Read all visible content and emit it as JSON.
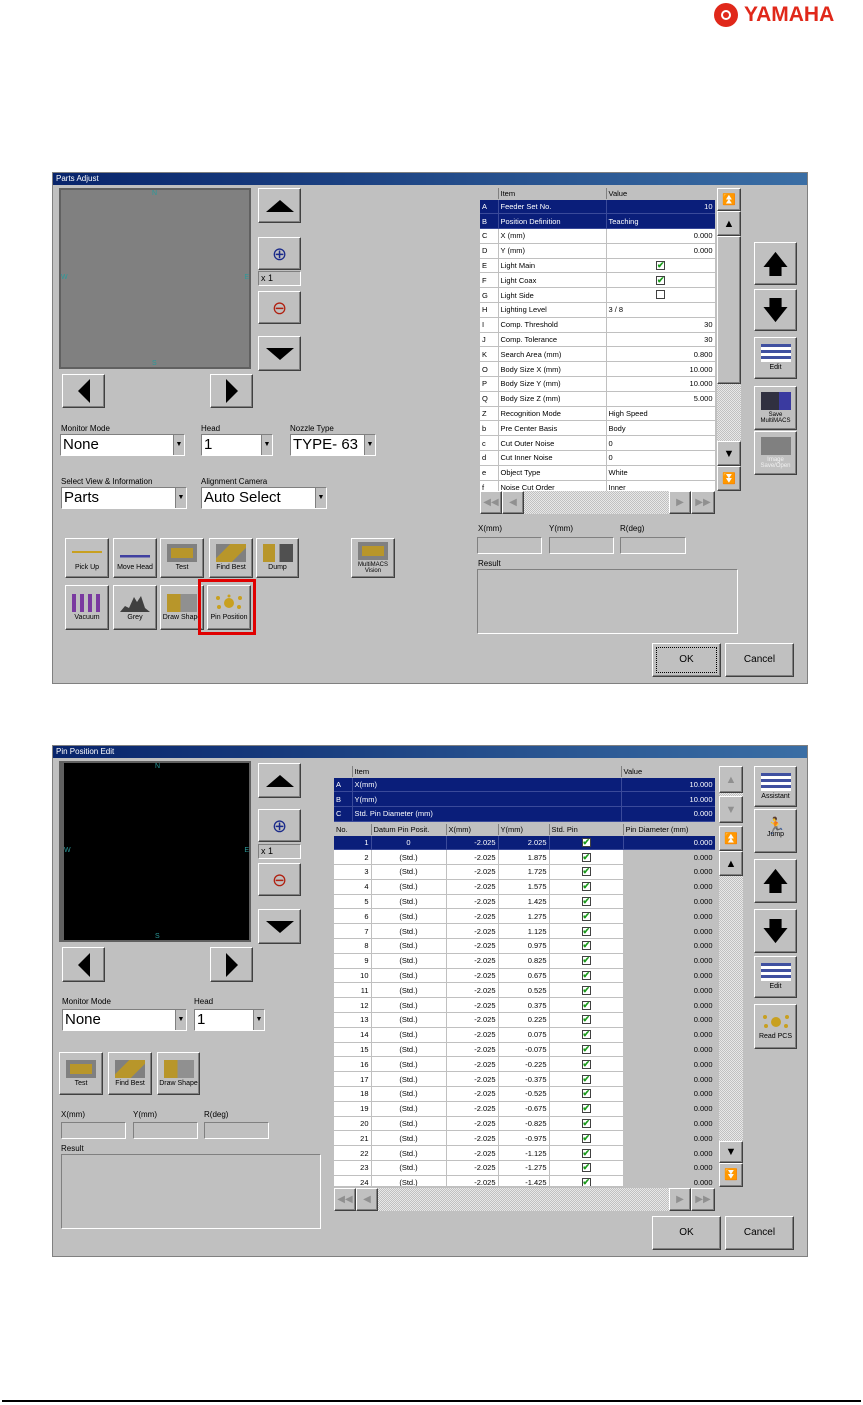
{
  "logo": {
    "text": "YAMAHA",
    "color": "#e0281a"
  },
  "win1": {
    "title": "Parts Adjust",
    "compass": {
      "n": "N",
      "s": "S",
      "e": "E",
      "w": "W"
    },
    "zoom_level": "x 1",
    "monitor_mode": {
      "label": "Monitor Mode",
      "value": "None"
    },
    "head": {
      "label": "Head",
      "value": "1"
    },
    "nozzle_type": {
      "label": "Nozzle Type",
      "value": "TYPE- 63"
    },
    "select_view": {
      "label": "Select View & Information",
      "value": "Parts"
    },
    "align_camera": {
      "label": "Alignment Camera",
      "value": "Auto Select"
    },
    "tools": {
      "pick_up": "Pick Up",
      "move_head": "Move Head",
      "test": "Test",
      "find_best": "Find Best",
      "dump": "Dump",
      "multimacs": "MultiMACS Vision",
      "vacuum": "Vacuum",
      "grey": "Grey",
      "draw_shape": "Draw Shape",
      "pin_position": "Pin Position"
    },
    "table": {
      "col_item": "Item",
      "col_value": "Value",
      "rows": [
        [
          "A",
          "Feeder Set No.",
          "10",
          "r"
        ],
        [
          "B",
          "Position Definition",
          "Teaching",
          "l"
        ],
        [
          "C",
          "X (mm)",
          "0.000",
          "r"
        ],
        [
          "D",
          "Y (mm)",
          "0.000",
          "r"
        ],
        [
          "E",
          "Light Main",
          "✔",
          "c"
        ],
        [
          "F",
          "Light Coax",
          "✔",
          "c"
        ],
        [
          "G",
          "Light Side",
          "",
          "c"
        ],
        [
          "H",
          "Lighting Level",
          "3 / 8",
          "l"
        ],
        [
          "I",
          "Comp. Threshold",
          "30",
          "r"
        ],
        [
          "J",
          "Comp. Tolerance",
          "30",
          "r"
        ],
        [
          "K",
          "Search Area (mm)",
          "0.800",
          "r"
        ],
        [
          "O",
          "Body Size X (mm)",
          "10.000",
          "r"
        ],
        [
          "P",
          "Body Size Y (mm)",
          "10.000",
          "r"
        ],
        [
          "Q",
          "Body Size Z (mm)",
          "5.000",
          "r"
        ],
        [
          "Z",
          "Recognition Mode",
          "High Speed",
          "l"
        ],
        [
          "b",
          "Pre Center Basis",
          "Body",
          "l"
        ],
        [
          "c",
          "Cut Outer Noise",
          "0",
          "l"
        ],
        [
          "d",
          "Cut Inner Noise",
          "0",
          "l"
        ],
        [
          "e",
          "Object Type",
          "White",
          "l"
        ],
        [
          "f",
          "Noise Cut Order",
          "Inner",
          "l"
        ]
      ]
    },
    "side": {
      "edit": "Edit",
      "save": "Save MultiMACS",
      "image": "Image Save/Open"
    },
    "x_label": "X(mm)",
    "y_label": "Y(mm)",
    "r_label": "R(deg)",
    "result_label": "Result",
    "ok": "OK",
    "cancel": "Cancel"
  },
  "win2": {
    "title": "Pin Position Edit",
    "compass": {
      "n": "N",
      "s": "S",
      "e": "E",
      "w": "W"
    },
    "zoom_level": "x 1",
    "monitor_mode": {
      "label": "Monitor Mode",
      "value": "None"
    },
    "head": {
      "label": "Head",
      "value": "1"
    },
    "tools": {
      "test": "Test",
      "find_best": "Find Best",
      "draw_shape": "Draw Shape"
    },
    "x_label": "X(mm)",
    "y_label": "Y(mm)",
    "r_label": "R(deg)",
    "result_label": "Result",
    "top_table": {
      "col_item": "Item",
      "col_value": "Value",
      "rows": [
        [
          "A",
          "X(mm)",
          "10.000"
        ],
        [
          "B",
          "Y(mm)",
          "10.000"
        ],
        [
          "C",
          "Std. Pin Diameter (mm)",
          "0.000"
        ]
      ]
    },
    "pin_table": {
      "cols": [
        "No.",
        "Datum Pin Posit.",
        "X(mm)",
        "Y(mm)",
        "Std. Pin",
        "Pin Diameter (mm)"
      ],
      "rows": [
        [
          "1",
          "0",
          "-2.025",
          "2.025",
          "✔",
          "0.000"
        ],
        [
          "2",
          "(Std.)",
          "-2.025",
          "1.875",
          "✔",
          "0.000"
        ],
        [
          "3",
          "(Std.)",
          "-2.025",
          "1.725",
          "✔",
          "0.000"
        ],
        [
          "4",
          "(Std.)",
          "-2.025",
          "1.575",
          "✔",
          "0.000"
        ],
        [
          "5",
          "(Std.)",
          "-2.025",
          "1.425",
          "✔",
          "0.000"
        ],
        [
          "6",
          "(Std.)",
          "-2.025",
          "1.275",
          "✔",
          "0.000"
        ],
        [
          "7",
          "(Std.)",
          "-2.025",
          "1.125",
          "✔",
          "0.000"
        ],
        [
          "8",
          "(Std.)",
          "-2.025",
          "0.975",
          "✔",
          "0.000"
        ],
        [
          "9",
          "(Std.)",
          "-2.025",
          "0.825",
          "✔",
          "0.000"
        ],
        [
          "10",
          "(Std.)",
          "-2.025",
          "0.675",
          "✔",
          "0.000"
        ],
        [
          "11",
          "(Std.)",
          "-2.025",
          "0.525",
          "✔",
          "0.000"
        ],
        [
          "12",
          "(Std.)",
          "-2.025",
          "0.375",
          "✔",
          "0.000"
        ],
        [
          "13",
          "(Std.)",
          "-2.025",
          "0.225",
          "✔",
          "0.000"
        ],
        [
          "14",
          "(Std.)",
          "-2.025",
          "0.075",
          "✔",
          "0.000"
        ],
        [
          "15",
          "(Std.)",
          "-2.025",
          "-0.075",
          "✔",
          "0.000"
        ],
        [
          "16",
          "(Std.)",
          "-2.025",
          "-0.225",
          "✔",
          "0.000"
        ],
        [
          "17",
          "(Std.)",
          "-2.025",
          "-0.375",
          "✔",
          "0.000"
        ],
        [
          "18",
          "(Std.)",
          "-2.025",
          "-0.525",
          "✔",
          "0.000"
        ],
        [
          "19",
          "(Std.)",
          "-2.025",
          "-0.675",
          "✔",
          "0.000"
        ],
        [
          "20",
          "(Std.)",
          "-2.025",
          "-0.825",
          "✔",
          "0.000"
        ],
        [
          "21",
          "(Std.)",
          "-2.025",
          "-0.975",
          "✔",
          "0.000"
        ],
        [
          "22",
          "(Std.)",
          "-2.025",
          "-1.125",
          "✔",
          "0.000"
        ],
        [
          "23",
          "(Std.)",
          "-2.025",
          "-1.275",
          "✔",
          "0.000"
        ],
        [
          "24",
          "(Std.)",
          "-2.025",
          "-1.425",
          "✔",
          "0.000"
        ]
      ]
    },
    "side": {
      "assistant": "Assistant",
      "jump": "Jump",
      "edit": "Edit",
      "read_pcs": "Read PCS"
    },
    "ok": "OK",
    "cancel": "Cancel"
  }
}
